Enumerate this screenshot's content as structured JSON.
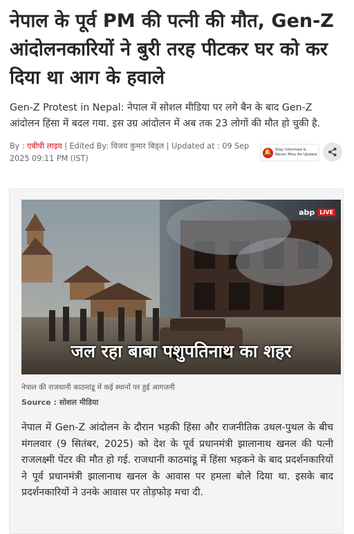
{
  "article": {
    "headline": "नेपाल के पूर्व PM की पत्नी की मौत, Gen-Z आंदोलनकारियों ने बुरी तरह पीटकर घर को कर दिया था आग के हवाले",
    "summary": "Gen-Z Protest in Nepal: नेपाल में सोशल मीडिया पर लगे बैन के बाद Gen-Z आंदोलन हिंसा में बदल गया. इस उग्र आंदोलन में अब तक 23 लोगों की मौत हो चुकी है.",
    "byline": {
      "by_label": "By : ",
      "source": "एबीपी लाइव",
      "edited_by": " | Edited By: विजय कुमार बिड्ल | Updated at : 09 Sep 2025 09:11 PM (IST)"
    },
    "notify_text": "Stay Informed & Never Miss An Update",
    "hero": {
      "channel_logo": "abp",
      "live_badge": "LIVE",
      "overlay_text": "जल रहा बाबा पशुपतिनाथ का शहर"
    },
    "image_caption": "नेपाल की राजधानी काठमांडू में कई स्थानों पर हुई आगजनी",
    "image_source": "Source : सोशल मीडिया",
    "body": "नेपाल में Gen-Z आंदोलन के दौरान भड़की हिंसा और राजनीतिक उथल-पुथल के बीच मंगलवार (9 सितंबर, 2025) को देश के पूर्व प्रधानमंत्री झालानाथ खनल की पत्नी राजलक्ष्मी पेंटर की मौत हो गई. राजधानी काठमांडू में हिंसा भड़कने के बाद प्रदर्शनकारियों ने पूर्व प्रधानमंत्री झालानाथ खनल के आवास पर हमला बोले दिया था. इसके बाद प्रदर्शनकारियों ने उनके आवास पर तोड़फोड़ मचा दी."
  },
  "icons": {
    "bell": "bell-icon",
    "share": "share-icon"
  },
  "colors": {
    "accent_red": "#e1131c",
    "source_link": "#d1121a"
  }
}
